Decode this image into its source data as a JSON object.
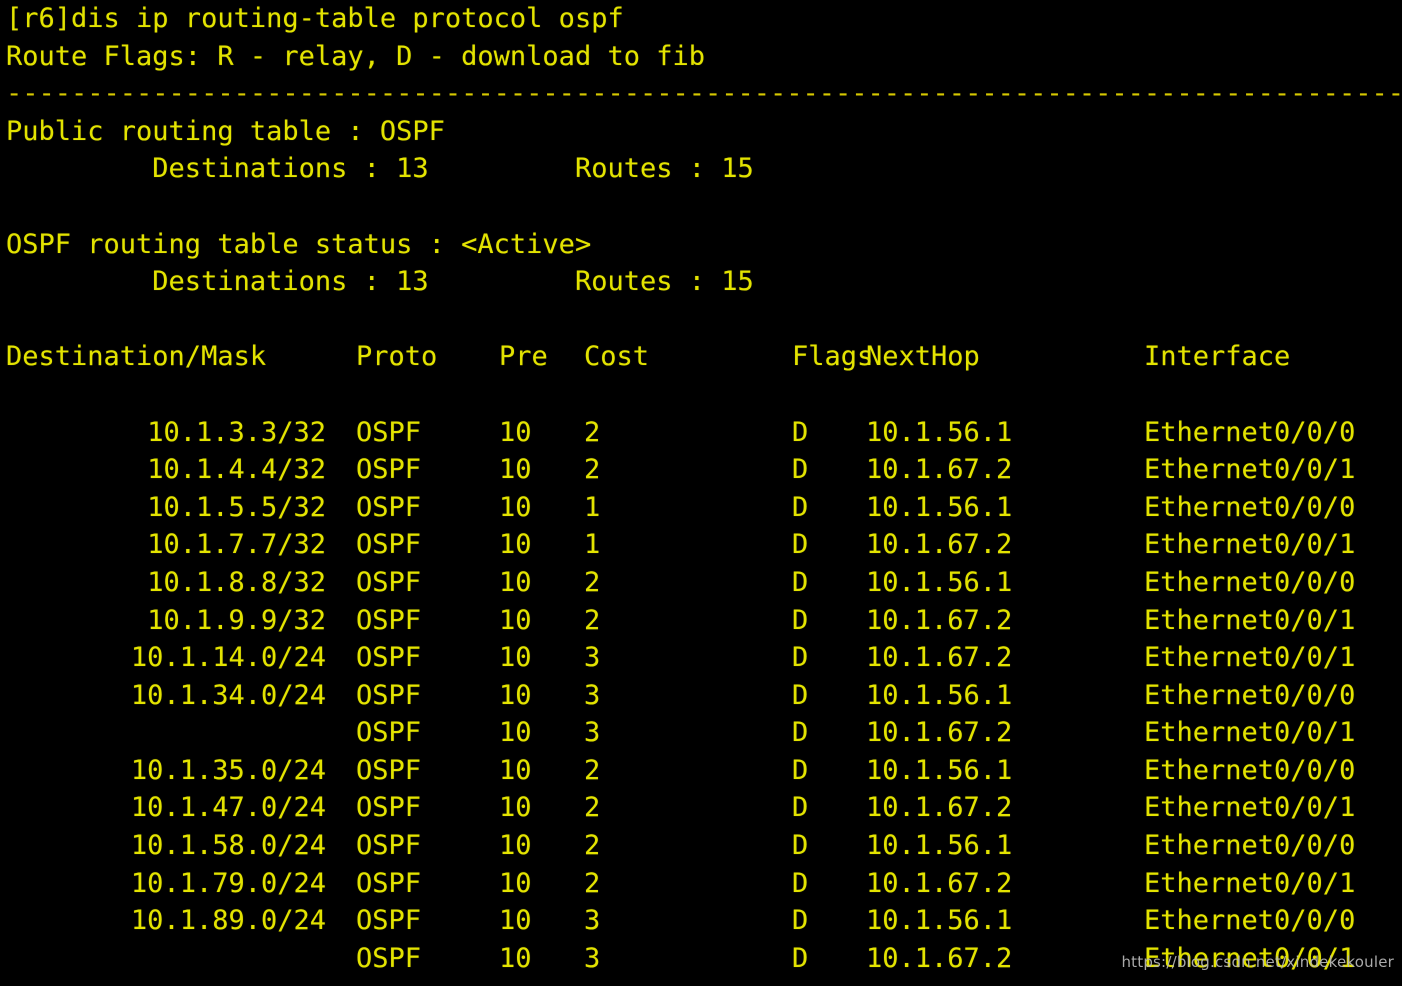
{
  "terminal": {
    "prompt_line": "[r6]dis ip routing-table protocol ospf",
    "route_flags_line": "Route Flags: R - relay, D - download to fib",
    "separator": "------------------------------------------------------------------------------------------------",
    "public_table_line": "Public routing table : OSPF",
    "public_counts_line": "         Destinations : 13         Routes : 15",
    "status_line": "OSPF routing table status : <Active>",
    "status_counts_line": "         Destinations : 13         Routes : 15",
    "blank": " ",
    "text_color": "#e3e300",
    "background_color": "#000000"
  },
  "table": {
    "headers": {
      "destination": "Destination/Mask",
      "proto": "Proto",
      "pre": "Pre",
      "cost": "Cost",
      "flags": "Flags",
      "nexthop": "NextHop",
      "interface": "Interface"
    },
    "rows": [
      {
        "destination": "10.1.3.3/32",
        "proto": "OSPF",
        "pre": "10",
        "cost": "2",
        "flags": "D",
        "nexthop": "10.1.56.1",
        "interface": "Ethernet0/0/0"
      },
      {
        "destination": "10.1.4.4/32",
        "proto": "OSPF",
        "pre": "10",
        "cost": "2",
        "flags": "D",
        "nexthop": "10.1.67.2",
        "interface": "Ethernet0/0/1"
      },
      {
        "destination": "10.1.5.5/32",
        "proto": "OSPF",
        "pre": "10",
        "cost": "1",
        "flags": "D",
        "nexthop": "10.1.56.1",
        "interface": "Ethernet0/0/0"
      },
      {
        "destination": "10.1.7.7/32",
        "proto": "OSPF",
        "pre": "10",
        "cost": "1",
        "flags": "D",
        "nexthop": "10.1.67.2",
        "interface": "Ethernet0/0/1"
      },
      {
        "destination": "10.1.8.8/32",
        "proto": "OSPF",
        "pre": "10",
        "cost": "2",
        "flags": "D",
        "nexthop": "10.1.56.1",
        "interface": "Ethernet0/0/0"
      },
      {
        "destination": "10.1.9.9/32",
        "proto": "OSPF",
        "pre": "10",
        "cost": "2",
        "flags": "D",
        "nexthop": "10.1.67.2",
        "interface": "Ethernet0/0/1"
      },
      {
        "destination": "10.1.14.0/24",
        "proto": "OSPF",
        "pre": "10",
        "cost": "3",
        "flags": "D",
        "nexthop": "10.1.67.2",
        "interface": "Ethernet0/0/1"
      },
      {
        "destination": "10.1.34.0/24",
        "proto": "OSPF",
        "pre": "10",
        "cost": "3",
        "flags": "D",
        "nexthop": "10.1.56.1",
        "interface": "Ethernet0/0/0"
      },
      {
        "destination": "",
        "proto": "OSPF",
        "pre": "10",
        "cost": "3",
        "flags": "D",
        "nexthop": "10.1.67.2",
        "interface": "Ethernet0/0/1"
      },
      {
        "destination": "10.1.35.0/24",
        "proto": "OSPF",
        "pre": "10",
        "cost": "2",
        "flags": "D",
        "nexthop": "10.1.56.1",
        "interface": "Ethernet0/0/0"
      },
      {
        "destination": "10.1.47.0/24",
        "proto": "OSPF",
        "pre": "10",
        "cost": "2",
        "flags": "D",
        "nexthop": "10.1.67.2",
        "interface": "Ethernet0/0/1"
      },
      {
        "destination": "10.1.58.0/24",
        "proto": "OSPF",
        "pre": "10",
        "cost": "2",
        "flags": "D",
        "nexthop": "10.1.56.1",
        "interface": "Ethernet0/0/0"
      },
      {
        "destination": "10.1.79.0/24",
        "proto": "OSPF",
        "pre": "10",
        "cost": "2",
        "flags": "D",
        "nexthop": "10.1.67.2",
        "interface": "Ethernet0/0/1"
      },
      {
        "destination": "10.1.89.0/24",
        "proto": "OSPF",
        "pre": "10",
        "cost": "3",
        "flags": "D",
        "nexthop": "10.1.56.1",
        "interface": "Ethernet0/0/0"
      },
      {
        "destination": "",
        "proto": "OSPF",
        "pre": "10",
        "cost": "3",
        "flags": "D",
        "nexthop": "10.1.67.2",
        "interface": "Ethernet0/0/1"
      }
    ]
  },
  "watermark": {
    "text": "https://blog.csdn.net/xindekekouler"
  }
}
